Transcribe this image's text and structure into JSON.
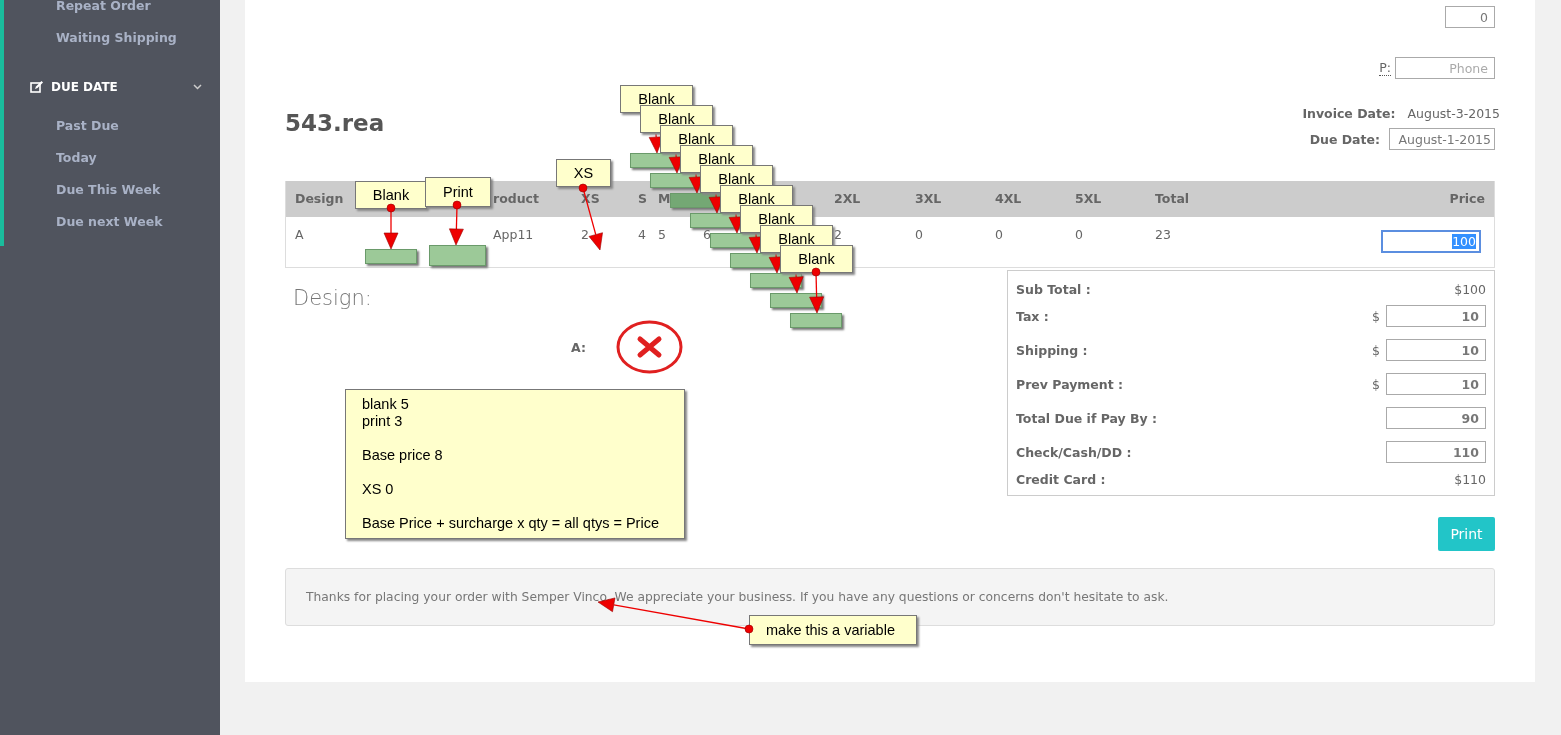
{
  "sidebar": {
    "items": [
      {
        "label": "Repeat Order"
      },
      {
        "label": "Waiting Shipping"
      }
    ],
    "sections": [
      {
        "title": "DUE DATE",
        "expanded": true,
        "items": [
          {
            "label": "Past Due"
          },
          {
            "label": "Today"
          },
          {
            "label": "Due This Week"
          },
          {
            "label": "Due next Week"
          }
        ]
      }
    ]
  },
  "invoice": {
    "top_field": {
      "value": "0"
    },
    "phone": {
      "label": "P:",
      "placeholder": "Phone"
    },
    "title": "543.rea",
    "invoice_date": {
      "label": "Invoice Date:",
      "value": "August-3-2015"
    },
    "due_date": {
      "label": "Due Date:",
      "value": "August-1-2015"
    }
  },
  "table": {
    "columns": [
      "Design",
      "",
      "",
      "roduct",
      "XS",
      "S",
      "M",
      "",
      "",
      "2XL",
      "3XL",
      "4XL",
      "5XL",
      "Total",
      "Price"
    ],
    "rows": [
      {
        "cells": [
          "A",
          "",
          "",
          "App11",
          "2",
          "4",
          "5",
          "6",
          "",
          "2",
          "0",
          "0",
          "0",
          "23"
        ],
        "price": "100",
        "focused": true
      }
    ]
  },
  "design": {
    "heading": "Design:",
    "items": [
      {
        "label": "A:",
        "valid": false
      }
    ]
  },
  "totals": {
    "rows": [
      {
        "kind": "text",
        "label": "Sub Total :",
        "value": "$100"
      },
      {
        "kind": "field",
        "label": "Tax :",
        "prefix": "$",
        "value": "10"
      },
      {
        "kind": "field",
        "label": "Shipping :",
        "prefix": "$",
        "value": "10"
      },
      {
        "kind": "field",
        "label": "Prev Payment :",
        "prefix": "$",
        "value": "10"
      },
      {
        "kind": "field",
        "label": "Total Due if Pay By :",
        "value": "90"
      },
      {
        "kind": "field",
        "label": "Check/Cash/DD :",
        "value": "110"
      },
      {
        "kind": "text",
        "label": "Credit Card :",
        "value": "$110"
      }
    ]
  },
  "print_button": "Print",
  "footer_message": "Thanks for placing your order with Semper Vinco. We appreciate your business. If you have any questions or concerns don't hesitate to ask.",
  "annotations": {
    "callouts": [
      {
        "text": "Blank",
        "target": {
          "selected": false
        }
      },
      {
        "text": "Print",
        "target": {
          "selected": false
        }
      },
      {
        "text": "XS"
      },
      {
        "text": "Blank",
        "target": {
          "selected": false
        }
      },
      {
        "text": "Blank",
        "target": {
          "selected": false
        }
      },
      {
        "text": "Blank",
        "target": {
          "selected": true
        }
      },
      {
        "text": "Blank",
        "target": {
          "selected": false
        }
      },
      {
        "text": "Blank",
        "target": {
          "selected": false
        }
      },
      {
        "text": "Blank",
        "target": {
          "selected": false
        }
      },
      {
        "text": "Blank",
        "target": {
          "selected": false
        }
      },
      {
        "text": "Blank",
        "target": {
          "selected": false
        }
      },
      {
        "text": "Blank",
        "target": {
          "selected": false
        }
      },
      {
        "text": "make this a variable"
      }
    ],
    "note": {
      "paragraphs": [
        "blank 5\nprint 3",
        "Base price 8",
        "XS 0",
        "Base Price + surcharge x qty = all qtys = Price"
      ]
    }
  }
}
